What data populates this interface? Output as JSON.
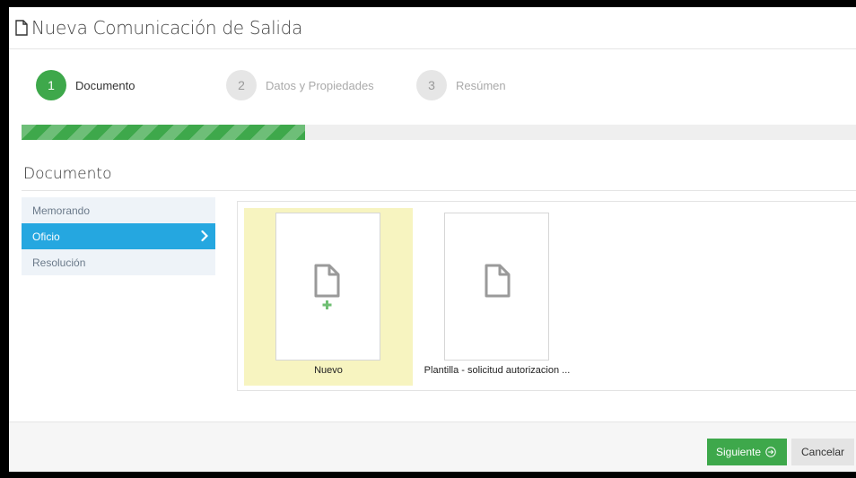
{
  "window": {
    "title": "Nueva Comunicación de Salida",
    "title_icon": "document-icon"
  },
  "wizard": {
    "steps": [
      {
        "number": "1",
        "label": "Documento",
        "state": "active"
      },
      {
        "number": "2",
        "label": "Datos y Propiedades",
        "state": "inactive"
      },
      {
        "number": "3",
        "label": "Resúmen",
        "state": "inactive"
      }
    ],
    "progress_fraction": 0.34
  },
  "section": {
    "title": "Documento"
  },
  "document_types": [
    {
      "label": "Memorando",
      "selected": false
    },
    {
      "label": "Oficio",
      "selected": true
    },
    {
      "label": "Resolución",
      "selected": false
    }
  ],
  "templates": [
    {
      "name": "Nuevo",
      "icon": "new-document-icon",
      "highlighted": true
    },
    {
      "name": "Plantilla - solicitud autorizacion ...",
      "icon": "document-icon",
      "highlighted": false
    }
  ],
  "footer": {
    "next_label": "Siguiente",
    "cancel_label": "Cancelar"
  },
  "colors": {
    "accent_green": "#3ea84b",
    "selected_blue": "#25a7e0",
    "highlight_yellow": "#f7f4c0"
  }
}
